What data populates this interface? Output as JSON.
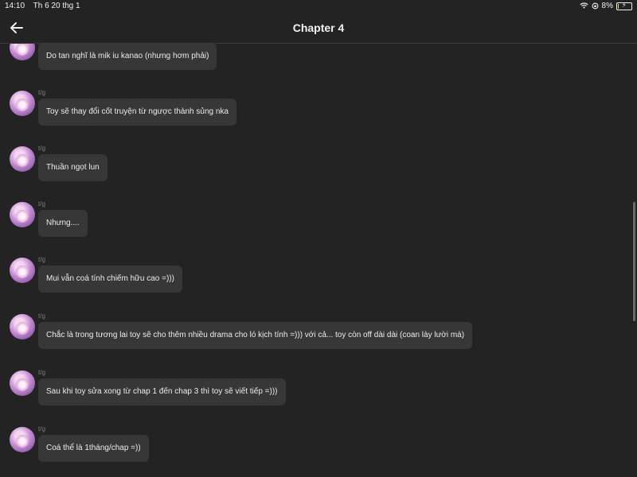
{
  "status_bar": {
    "time": "14:10",
    "date": "Th 6 20 thg 1",
    "battery": "8%"
  },
  "header": {
    "title": "Chapter 4"
  },
  "watermark": "",
  "messages": [
    {
      "author": "",
      "text": "Do tan nghĩ là mik iu kanao (nhưng hơm phải)"
    },
    {
      "author": "t/g",
      "text": "Toy sẽ thay đổi cốt truyện từ ngược thành sủng nka"
    },
    {
      "author": "t/g",
      "text": "Thuần ngọt lun"
    },
    {
      "author": "t/g",
      "text": "Nhưng...."
    },
    {
      "author": "t/g",
      "text": "Mui vẫn coá tính chiếm hữu cao =)))"
    },
    {
      "author": "t/g",
      "text": "Chắc là trong tương lai toy sẽ cho thêm nhiều drama cho ló kịch tính =))) với cả... toy còn off dài dài (coan lày lười mà)"
    },
    {
      "author": "t/g",
      "text": "Sau khi toy sửa xong từ chap 1 đến chap 3 thì toy sẽ viết tiếp =)))"
    },
    {
      "author": "t/g",
      "text": "Coá thể là 1tháng/chap =))"
    }
  ],
  "colors": {
    "background": "#232323",
    "bubble": "#373737",
    "author_text": "#7c7c7c"
  }
}
